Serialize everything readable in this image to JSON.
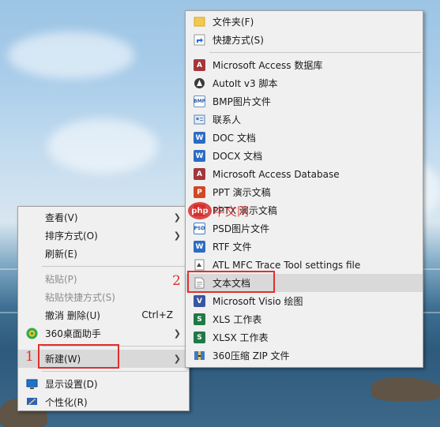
{
  "context_menu": {
    "items": [
      {
        "label": "查看(V)",
        "submenu": true
      },
      {
        "label": "排序方式(O)",
        "submenu": true
      },
      {
        "label": "刷新(E)"
      },
      {
        "label": "粘贴(P)",
        "disabled": true
      },
      {
        "label": "粘贴快捷方式(S)",
        "disabled": true
      },
      {
        "label": "撤消 删除(U)",
        "shortcut": "Ctrl+Z"
      },
      {
        "label": "360桌面助手",
        "icon": "360-assistant-icon",
        "submenu": true
      },
      {
        "label": "新建(W)",
        "submenu": true,
        "highlighted": true
      },
      {
        "label": "显示设置(D)",
        "icon": "display-settings-icon"
      },
      {
        "label": "个性化(R)",
        "icon": "personalize-icon"
      }
    ]
  },
  "new_submenu": {
    "items": [
      {
        "label": "文件夹(F)",
        "icon": "folder-icon"
      },
      {
        "label": "快捷方式(S)",
        "icon": "shortcut-icon"
      },
      {
        "label": "Microsoft Access 数据库",
        "icon": "access-icon"
      },
      {
        "label": "AutoIt v3 脚本",
        "icon": "autoit-icon"
      },
      {
        "label": "BMP图片文件",
        "icon": "bmp-icon"
      },
      {
        "label": "联系人",
        "icon": "contact-icon"
      },
      {
        "label": "DOC 文档",
        "icon": "word-doc-icon"
      },
      {
        "label": "DOCX 文档",
        "icon": "word-docx-icon"
      },
      {
        "label": "Microsoft Access Database",
        "icon": "access-db-icon"
      },
      {
        "label": "PPT 演示文稿",
        "icon": "ppt-icon"
      },
      {
        "label": "PPTX 演示文稿",
        "icon": "pptx-icon"
      },
      {
        "label": "PSD图片文件",
        "icon": "psd-icon"
      },
      {
        "label": "RTF 文件",
        "icon": "rtf-icon"
      },
      {
        "label": "ATL MFC Trace Tool settings file",
        "icon": "atl-trace-icon"
      },
      {
        "label": "文本文档",
        "icon": "text-doc-icon",
        "highlighted": true
      },
      {
        "label": "Microsoft Visio 绘图",
        "icon": "visio-icon"
      },
      {
        "label": "XLS 工作表",
        "icon": "xls-icon"
      },
      {
        "label": "XLSX 工作表",
        "icon": "xlsx-icon"
      },
      {
        "label": "360压缩 ZIP 文件",
        "icon": "zip-icon"
      }
    ]
  },
  "annotations": {
    "step1": "1",
    "step2": "2",
    "color": "#e0302c"
  },
  "watermark": {
    "logo": "php",
    "text": "中文网"
  },
  "colors": {
    "menu_bg": "#f0f0f0",
    "highlight_bg": "#d9d9d9",
    "disabled_text": "#8d8d8d"
  }
}
